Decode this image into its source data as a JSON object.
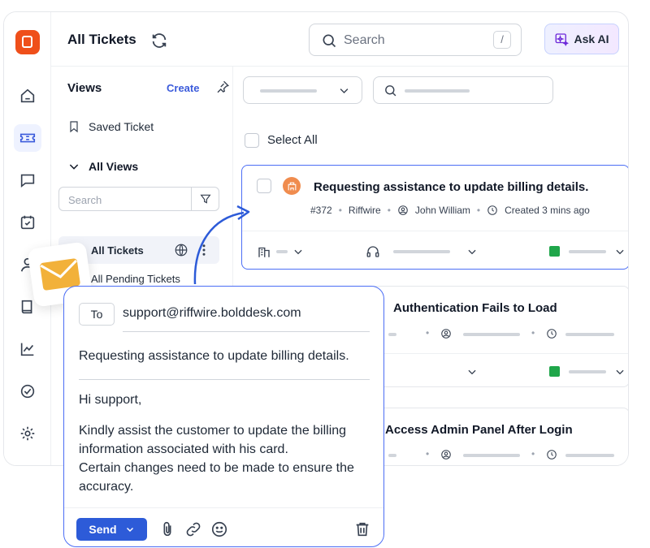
{
  "header": {
    "title": "All Tickets",
    "search_placeholder": "Search",
    "search_shortcut": "/",
    "ask_ai_label": "Ask AI"
  },
  "rail": {
    "items": [
      "home-icon",
      "ticket-icon",
      "chat-icon",
      "calendar-check-icon",
      "user-icon",
      "book-icon",
      "chart-icon",
      "check-circle-icon",
      "gear-icon"
    ],
    "active": "ticket-icon"
  },
  "views": {
    "title": "Views",
    "create_label": "Create",
    "saved_label": "Saved Ticket",
    "all_views_label": "All Views",
    "search_placeholder": "Search",
    "items": [
      {
        "label": "All Tickets",
        "active": true
      },
      {
        "label": "All Pending Tickets",
        "active": false
      }
    ]
  },
  "list": {
    "select_all_label": "Select All",
    "tickets": [
      {
        "title": "Requesting assistance to update billing details.",
        "id": "#372",
        "org": "Riffwire",
        "assignee": "John William",
        "created": "Created 3 mins ago"
      },
      {
        "title": "Authentication Fails to Load"
      },
      {
        "title": "Access Admin Panel After Login"
      }
    ]
  },
  "compose": {
    "to_label": "To",
    "to_value": "support@riffwire.bolddesk.com",
    "subject": "Requesting assistance to update billing details.",
    "greeting": "Hi support,",
    "body_lines": [
      "Kindly assist the customer to update the billing",
      "information associated with his card.",
      "Certain changes need to be made to ensure the",
      "accuracy."
    ],
    "send_label": "Send"
  },
  "colors": {
    "accent": "#2d5bd8",
    "brand": "#ef4f1a",
    "status_green": "#1fa64a"
  }
}
